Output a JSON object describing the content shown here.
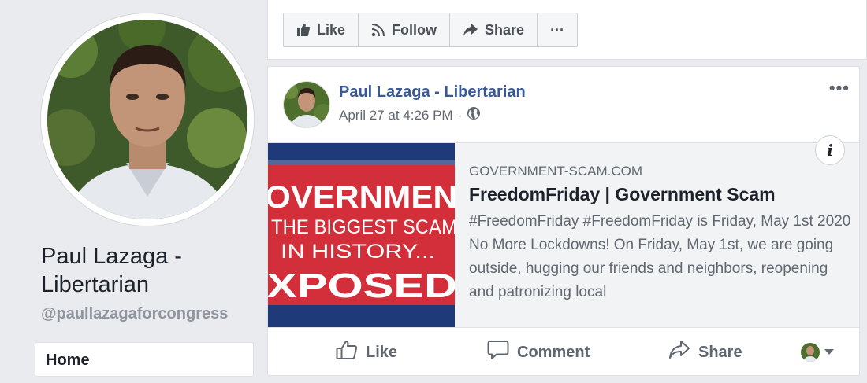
{
  "profile": {
    "name": "Paul Lazaga - Libertarian",
    "handle": "@paullazagaforcongress"
  },
  "nav": {
    "home_label": "Home"
  },
  "page_actions": {
    "like_label": "Like",
    "follow_label": "Follow",
    "share_label": "Share",
    "more_label": "···"
  },
  "post": {
    "author": "Paul Lazaga - Libertarian",
    "timestamp": "April 27 at 4:26 PM",
    "separator": "·",
    "privacy_icon": "globe-icon",
    "more_label": "•••",
    "link": {
      "domain": "GOVERNMENT-SCAM.COM",
      "title": "FreedomFriday | Government Scam",
      "description": "#FreedomFriday #FreedomFriday is Friday, May 1st 2020  No More Lockdowns! On Friday, May 1st, we are going outside, hugging our friends and neighbors, reopening and patronizing local",
      "thumbnail_lines": [
        "OVERNMEN",
        "THE BIGGEST SCAM",
        "IN HISTORY...",
        "XPOSED"
      ],
      "info_label": "i"
    },
    "actions": {
      "like_label": "Like",
      "comment_label": "Comment",
      "share_label": "Share"
    }
  },
  "colors": {
    "link_blue": "#385898",
    "page_bg": "#e9ebee",
    "thumb_red": "#d32f3a",
    "thumb_navy": "#1e3a78"
  }
}
